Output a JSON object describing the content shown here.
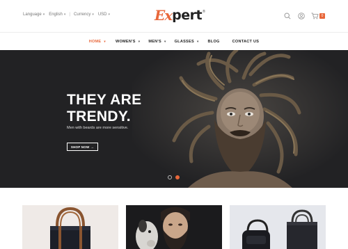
{
  "header": {
    "language_label": "Language",
    "language_value": "English",
    "currency_label": "Currency",
    "currency_value": "USD",
    "logo_part1": "Ex",
    "logo_part2": "pert",
    "logo_mark": "®",
    "cart_count": "0",
    "icons": [
      "search-icon",
      "user-icon",
      "cart-icon"
    ]
  },
  "nav": {
    "items": [
      {
        "label": "HOME",
        "dropdown": true,
        "active": true
      },
      {
        "label": "WOMEN'S",
        "dropdown": true
      },
      {
        "label": "MEN'S",
        "dropdown": true
      },
      {
        "label": "GLASSES",
        "dropdown": true
      },
      {
        "label": "BLOG",
        "dropdown": false
      },
      {
        "label": "CONTACT US",
        "dropdown": false
      }
    ]
  },
  "hero": {
    "title": "THEY ARE\nTRENDY.",
    "subtitle": "Men with beards are more sensitive.",
    "button_label": "SHOP NOW",
    "slides": 2,
    "active_slide": 2
  },
  "colors": {
    "accent": "#e8673a",
    "hero_bg": "#222224",
    "text_dark": "#222222"
  }
}
